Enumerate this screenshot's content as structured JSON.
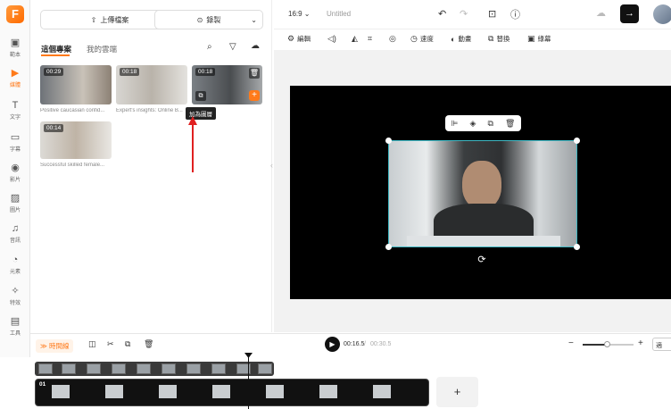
{
  "nav": {
    "items": [
      {
        "label": "範本",
        "icon": "template-icon"
      },
      {
        "label": "媒體",
        "icon": "media-icon"
      },
      {
        "label": "文字",
        "icon": "text-icon"
      },
      {
        "label": "字幕",
        "icon": "subtitle-icon"
      },
      {
        "label": "影片",
        "icon": "video-icon"
      },
      {
        "label": "圖片",
        "icon": "image-icon"
      },
      {
        "label": "音訊",
        "icon": "audio-icon"
      },
      {
        "label": "元素",
        "icon": "elements-icon"
      },
      {
        "label": "特效",
        "icon": "effects-icon"
      },
      {
        "label": "工具",
        "icon": "tools-icon"
      }
    ]
  },
  "media": {
    "upload_label": "上傳檔案",
    "record_label": "錄製",
    "tab_project": "這個專案",
    "tab_mine": "我的雲端",
    "thumbs": [
      {
        "duration": "00:29",
        "caption": "Positive caucasian confid..."
      },
      {
        "duration": "00:18",
        "caption": "Expert's insights: Online B..."
      },
      {
        "duration": "00:18",
        "caption": ""
      },
      {
        "duration": "00:14",
        "caption": "Successful skilled female..."
      }
    ],
    "tooltip": "加為圖層"
  },
  "header": {
    "ratio": "16:9",
    "title": "Untitled"
  },
  "toolbar": {
    "items": [
      "編輯",
      "速度",
      "動畫",
      "替換",
      "綠幕"
    ]
  },
  "timeline": {
    "time_label": "時間線",
    "current_time": "00:16.5",
    "total_time": "00:30.5",
    "track_index": "01",
    "add_label": "+",
    "fit_label": "適"
  },
  "colors": {
    "accent": "#ff7a1a",
    "selection": "#3fb8c4"
  }
}
